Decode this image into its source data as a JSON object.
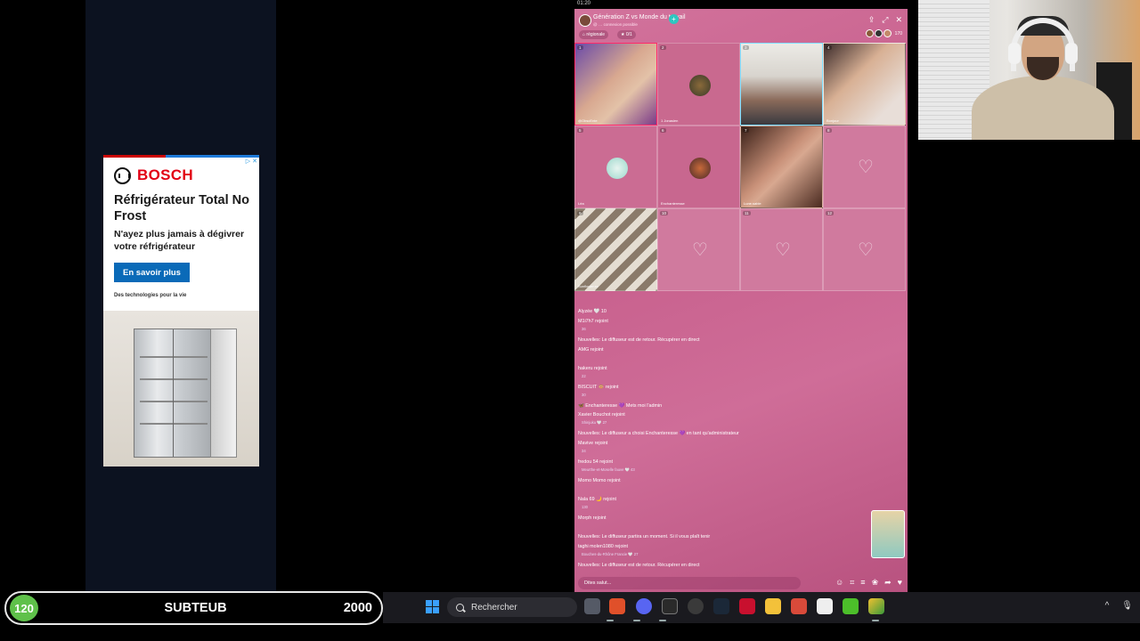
{
  "system": {
    "clock": "01:20"
  },
  "ad": {
    "adchoice": "▷ ✕",
    "brand": "BOSCH",
    "headline": "Réfrigérateur Total No Frost",
    "subline": "N'ayez plus jamais à dégivrer votre réfrigérateur",
    "cta": "En savoir plus",
    "tagline": "Des technologies pour la vie"
  },
  "live": {
    "title": "Génération Z vs Monde du travail",
    "subtitle": "@ … connexion possible",
    "pill_regional": "régionale",
    "pill_stars": "0/1",
    "viewer_count": "170",
    "tiles": [
      {
        "badge": "1",
        "name": "@ObscEnte"
      },
      {
        "badge": "2",
        "name": "1 Jonasien"
      },
      {
        "badge": "3",
        "name": ""
      },
      {
        "badge": "4",
        "name": "Bonjour"
      },
      {
        "badge": "5",
        "name": "Léa"
      },
      {
        "badge": "6",
        "name": "Enchanteresse"
      },
      {
        "badge": "7",
        "name": "Lune.sable"
      },
      {
        "badge": "8",
        "name": ""
      },
      {
        "badge": "9",
        "name": "Sunflower.xx"
      },
      {
        "badge": "10",
        "name": ""
      },
      {
        "badge": "11",
        "name": ""
      },
      {
        "badge": "12",
        "name": ""
      }
    ],
    "chat": [
      {
        "text": "Alyzée  🤍 10",
        "sub": ""
      },
      {
        "text": "M1i7h7 rejoint",
        "sub": "36"
      },
      {
        "text": "Nouvelles: Le diffuseur est de retour. Récupérer en direct",
        "sub": ""
      },
      {
        "text": "AMG rejoint",
        "sub": ""
      },
      {
        "text": "hakeru rejoint",
        "sub": "22"
      },
      {
        "text": "BISCUIT 🐵 rejoint",
        "sub": "30"
      },
      {
        "text": "🦋 Enchanteresse 💜 Mets moi l'admin",
        "sub": ""
      },
      {
        "text": "Xavier Bouchot rejoint",
        "sub": "Shinjuku 🤍 27"
      },
      {
        "text": "Nouvelles: Le diffuseur a choisi Enchanteresse 💜 en tant qu'administrateur",
        "sub": ""
      },
      {
        "text": "Mavive rejoint",
        "sub": "34"
      },
      {
        "text": "fredou 54 rejoint",
        "sub": "Meurthe-et-Moselle fauve  🤍 43"
      },
      {
        "text": "Momo Momo rejoint",
        "sub": ""
      },
      {
        "text": "Nala 69 🌙 rejoint",
        "sub": "130"
      },
      {
        "text": "Morph rejoint",
        "sub": ""
      },
      {
        "text": "Nouvelles: Le diffuseur partira un moment. Si il vous plaît tenir",
        "sub": ""
      },
      {
        "text": "taghi molen1080 rejoint",
        "sub": "Bouches-du-Rhône Francie  🤍 27"
      },
      {
        "text": "Nouvelles: Le diffuseur est de retour. Récupérer en direct",
        "sub": ""
      }
    ],
    "input_placeholder": "Dites salut..."
  },
  "subgoal": {
    "count": "120",
    "label": "SUBTEUB",
    "goal": "2000"
  },
  "taskbar": {
    "search_label": "Rechercher"
  }
}
